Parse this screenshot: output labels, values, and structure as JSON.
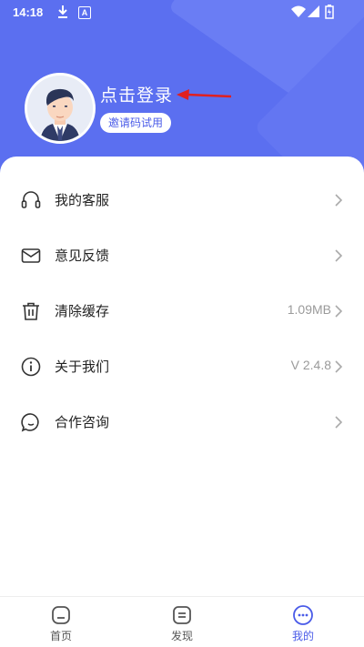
{
  "status_bar": {
    "time": "14:18"
  },
  "profile": {
    "login_text": "点击登录",
    "invite_button": "邀请码试用"
  },
  "menu": [
    {
      "label": "我的客服",
      "value": "",
      "icon": "headset-icon"
    },
    {
      "label": "意见反馈",
      "value": "",
      "icon": "mail-icon"
    },
    {
      "label": "清除缓存",
      "value": "1.09MB",
      "icon": "trash-icon"
    },
    {
      "label": "关于我们",
      "value": "V 2.4.8",
      "icon": "info-icon"
    },
    {
      "label": "合作咨询",
      "value": "",
      "icon": "chat-icon"
    }
  ],
  "tabs": [
    {
      "label": "首页",
      "active": false,
      "icon": "home-icon"
    },
    {
      "label": "发现",
      "active": false,
      "icon": "discover-icon"
    },
    {
      "label": "我的",
      "active": true,
      "icon": "profile-icon"
    }
  ],
  "colors": {
    "accent": "#5b6ff0",
    "active_tab": "#4a5be8",
    "annotation_arrow": "#e02020"
  }
}
